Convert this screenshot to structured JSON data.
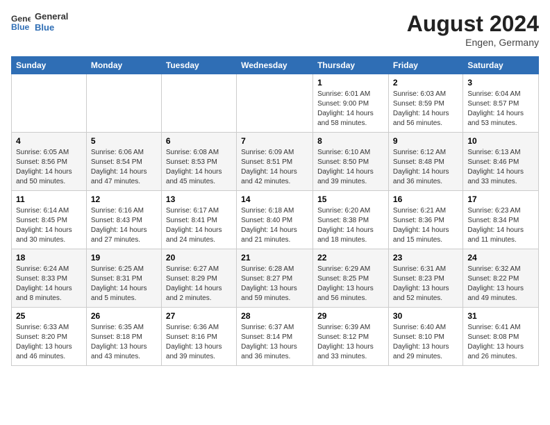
{
  "header": {
    "logo_line1": "General",
    "logo_line2": "Blue",
    "month_year": "August 2024",
    "location": "Engen, Germany"
  },
  "days_of_week": [
    "Sunday",
    "Monday",
    "Tuesday",
    "Wednesday",
    "Thursday",
    "Friday",
    "Saturday"
  ],
  "weeks": [
    [
      {
        "day": "",
        "info": ""
      },
      {
        "day": "",
        "info": ""
      },
      {
        "day": "",
        "info": ""
      },
      {
        "day": "",
        "info": ""
      },
      {
        "day": "1",
        "info": "Sunrise: 6:01 AM\nSunset: 9:00 PM\nDaylight: 14 hours and 58 minutes."
      },
      {
        "day": "2",
        "info": "Sunrise: 6:03 AM\nSunset: 8:59 PM\nDaylight: 14 hours and 56 minutes."
      },
      {
        "day": "3",
        "info": "Sunrise: 6:04 AM\nSunset: 8:57 PM\nDaylight: 14 hours and 53 minutes."
      }
    ],
    [
      {
        "day": "4",
        "info": "Sunrise: 6:05 AM\nSunset: 8:56 PM\nDaylight: 14 hours and 50 minutes."
      },
      {
        "day": "5",
        "info": "Sunrise: 6:06 AM\nSunset: 8:54 PM\nDaylight: 14 hours and 47 minutes."
      },
      {
        "day": "6",
        "info": "Sunrise: 6:08 AM\nSunset: 8:53 PM\nDaylight: 14 hours and 45 minutes."
      },
      {
        "day": "7",
        "info": "Sunrise: 6:09 AM\nSunset: 8:51 PM\nDaylight: 14 hours and 42 minutes."
      },
      {
        "day": "8",
        "info": "Sunrise: 6:10 AM\nSunset: 8:50 PM\nDaylight: 14 hours and 39 minutes."
      },
      {
        "day": "9",
        "info": "Sunrise: 6:12 AM\nSunset: 8:48 PM\nDaylight: 14 hours and 36 minutes."
      },
      {
        "day": "10",
        "info": "Sunrise: 6:13 AM\nSunset: 8:46 PM\nDaylight: 14 hours and 33 minutes."
      }
    ],
    [
      {
        "day": "11",
        "info": "Sunrise: 6:14 AM\nSunset: 8:45 PM\nDaylight: 14 hours and 30 minutes."
      },
      {
        "day": "12",
        "info": "Sunrise: 6:16 AM\nSunset: 8:43 PM\nDaylight: 14 hours and 27 minutes."
      },
      {
        "day": "13",
        "info": "Sunrise: 6:17 AM\nSunset: 8:41 PM\nDaylight: 14 hours and 24 minutes."
      },
      {
        "day": "14",
        "info": "Sunrise: 6:18 AM\nSunset: 8:40 PM\nDaylight: 14 hours and 21 minutes."
      },
      {
        "day": "15",
        "info": "Sunrise: 6:20 AM\nSunset: 8:38 PM\nDaylight: 14 hours and 18 minutes."
      },
      {
        "day": "16",
        "info": "Sunrise: 6:21 AM\nSunset: 8:36 PM\nDaylight: 14 hours and 15 minutes."
      },
      {
        "day": "17",
        "info": "Sunrise: 6:23 AM\nSunset: 8:34 PM\nDaylight: 14 hours and 11 minutes."
      }
    ],
    [
      {
        "day": "18",
        "info": "Sunrise: 6:24 AM\nSunset: 8:33 PM\nDaylight: 14 hours and 8 minutes."
      },
      {
        "day": "19",
        "info": "Sunrise: 6:25 AM\nSunset: 8:31 PM\nDaylight: 14 hours and 5 minutes."
      },
      {
        "day": "20",
        "info": "Sunrise: 6:27 AM\nSunset: 8:29 PM\nDaylight: 14 hours and 2 minutes."
      },
      {
        "day": "21",
        "info": "Sunrise: 6:28 AM\nSunset: 8:27 PM\nDaylight: 13 hours and 59 minutes."
      },
      {
        "day": "22",
        "info": "Sunrise: 6:29 AM\nSunset: 8:25 PM\nDaylight: 13 hours and 56 minutes."
      },
      {
        "day": "23",
        "info": "Sunrise: 6:31 AM\nSunset: 8:23 PM\nDaylight: 13 hours and 52 minutes."
      },
      {
        "day": "24",
        "info": "Sunrise: 6:32 AM\nSunset: 8:22 PM\nDaylight: 13 hours and 49 minutes."
      }
    ],
    [
      {
        "day": "25",
        "info": "Sunrise: 6:33 AM\nSunset: 8:20 PM\nDaylight: 13 hours and 46 minutes."
      },
      {
        "day": "26",
        "info": "Sunrise: 6:35 AM\nSunset: 8:18 PM\nDaylight: 13 hours and 43 minutes."
      },
      {
        "day": "27",
        "info": "Sunrise: 6:36 AM\nSunset: 8:16 PM\nDaylight: 13 hours and 39 minutes."
      },
      {
        "day": "28",
        "info": "Sunrise: 6:37 AM\nSunset: 8:14 PM\nDaylight: 13 hours and 36 minutes."
      },
      {
        "day": "29",
        "info": "Sunrise: 6:39 AM\nSunset: 8:12 PM\nDaylight: 13 hours and 33 minutes."
      },
      {
        "day": "30",
        "info": "Sunrise: 6:40 AM\nSunset: 8:10 PM\nDaylight: 13 hours and 29 minutes."
      },
      {
        "day": "31",
        "info": "Sunrise: 6:41 AM\nSunset: 8:08 PM\nDaylight: 13 hours and 26 minutes."
      }
    ]
  ]
}
